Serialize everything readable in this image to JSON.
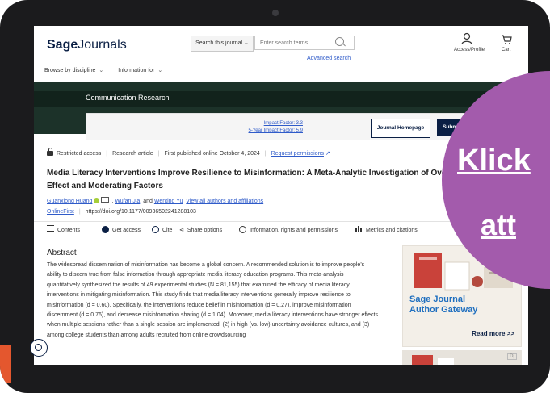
{
  "header": {
    "logo_prefix": "Sage",
    "logo_suffix": "Journals",
    "search_scope": "Search this journal",
    "search_placeholder": "Enter search terms...",
    "advanced_search": "Advanced search",
    "profile_label": "Access/Profile",
    "cart_label": "Cart"
  },
  "nav": {
    "items": [
      {
        "label": "Browse by discipline"
      },
      {
        "label": "Information for"
      }
    ]
  },
  "banner": {
    "journal_title": "Communication Research"
  },
  "infobar": {
    "impact_factor": "Impact Factor: 3.3",
    "five_year_impact": "5-Year Impact Factor: 5.9",
    "journal_homepage": "Journal Homepage",
    "submission_guidelines": "Submission Guidelines"
  },
  "article": {
    "access": "Restricted access",
    "type": "Research article",
    "published": "First published online October 4, 2024",
    "permissions": "Request permissions",
    "title": "Media Literacy Interventions Improve Resilience to Misinformation: A Meta-Analytic Investigation of Overall Effect and Moderating Factors",
    "authors": [
      "Guanxiong Huang",
      "Wufan Jia",
      "Wenting Yu"
    ],
    "authors_and": ", and",
    "view_all": "View all authors and affiliations",
    "status": "OnlineFirst",
    "doi": "https://doi.org/10.1177/00936502241288103"
  },
  "toolbar": {
    "contents": "Contents",
    "get_access": "Get access",
    "cite": "Cite",
    "share": "Share options",
    "information": "Information, rights and permissions",
    "metrics": "Metrics and citations"
  },
  "abstract": {
    "heading": "Abstract",
    "text": "The widespread dissemination of misinformation has become a global concern. A recommended solution is to improve people's ability to discern true from false information through appropriate media literacy education programs. This meta-analysis quantitatively synthesized the results of 49 experimental studies (N = 81,155) that examined the efficacy of media literacy interventions in mitigating misinformation. This study finds that media literacy interventions generally improve resilience to misinformation (d = 0.60). Specifically, the interventions reduce belief in misinformation (d = 0.27), improve misinformation discernment (d = 0.76), and decrease misinformation sharing (d = 1.04). Moreover, media literacy interventions have stronger effects when multiple sessions rather than a single session are implemented, (2) in high (vs. low) uncertainty avoidance cultures, and (3) among college students than among adults recruited from online crowdsourcing"
  },
  "ad": {
    "title_line1": "Sage Journal",
    "title_line2": "Author Gateway",
    "read_more": "Read more >>",
    "badge": "D|"
  },
  "overlay": {
    "line1": "Klick",
    "line2": "att"
  },
  "colors": {
    "navy": "#0a1f44",
    "banner_green": "#1c3229",
    "link_blue": "#2f5bc9",
    "overlay_purple": "#a35bac",
    "ad_blue": "#1f6fbf"
  }
}
